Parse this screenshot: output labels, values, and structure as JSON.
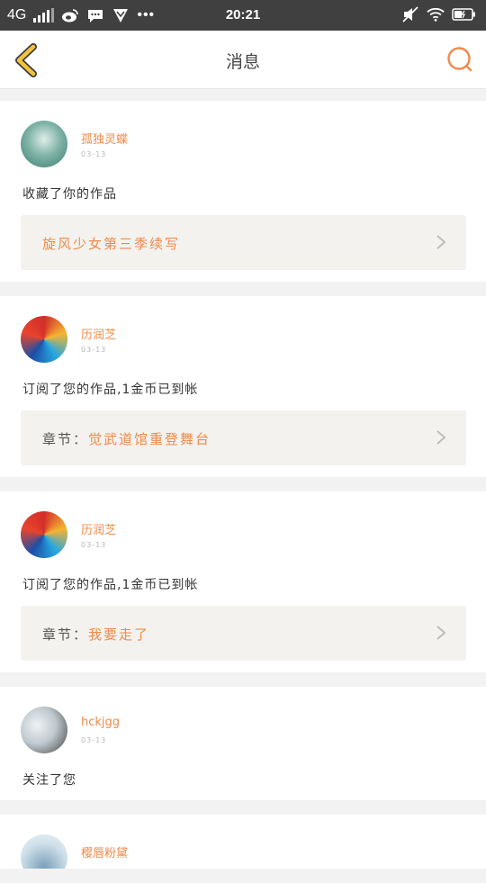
{
  "status_bar": {
    "network": "4G",
    "time": "20:21"
  },
  "header": {
    "title": "消息"
  },
  "colors": {
    "accent": "#f08a4b",
    "back_arrow": "#f3c33c"
  },
  "messages": [
    {
      "name": "孤独灵蝶",
      "date": "03-13",
      "text": "收藏了你的作品",
      "link_prefix": "",
      "link_value": "旋风少女第三季续写",
      "avatar": "girl-avatar"
    },
    {
      "name": "历润芝",
      "date": "03-13",
      "text": "订阅了您的作品,1金币已到帐",
      "link_prefix": "章节：",
      "link_value": "觉武道馆重登舞台",
      "avatar": "swirl-avatar"
    },
    {
      "name": "历润芝",
      "date": "03-13",
      "text": "订阅了您的作品,1金币已到帐",
      "link_prefix": "章节：",
      "link_value": "我要走了",
      "avatar": "swirl-avatar"
    },
    {
      "name": "hckjgg",
      "date": "03-13",
      "text": "关注了您",
      "avatar": "photo-avatar"
    },
    {
      "name": "樱唇粉黛",
      "avatar": "boy-avatar"
    }
  ]
}
